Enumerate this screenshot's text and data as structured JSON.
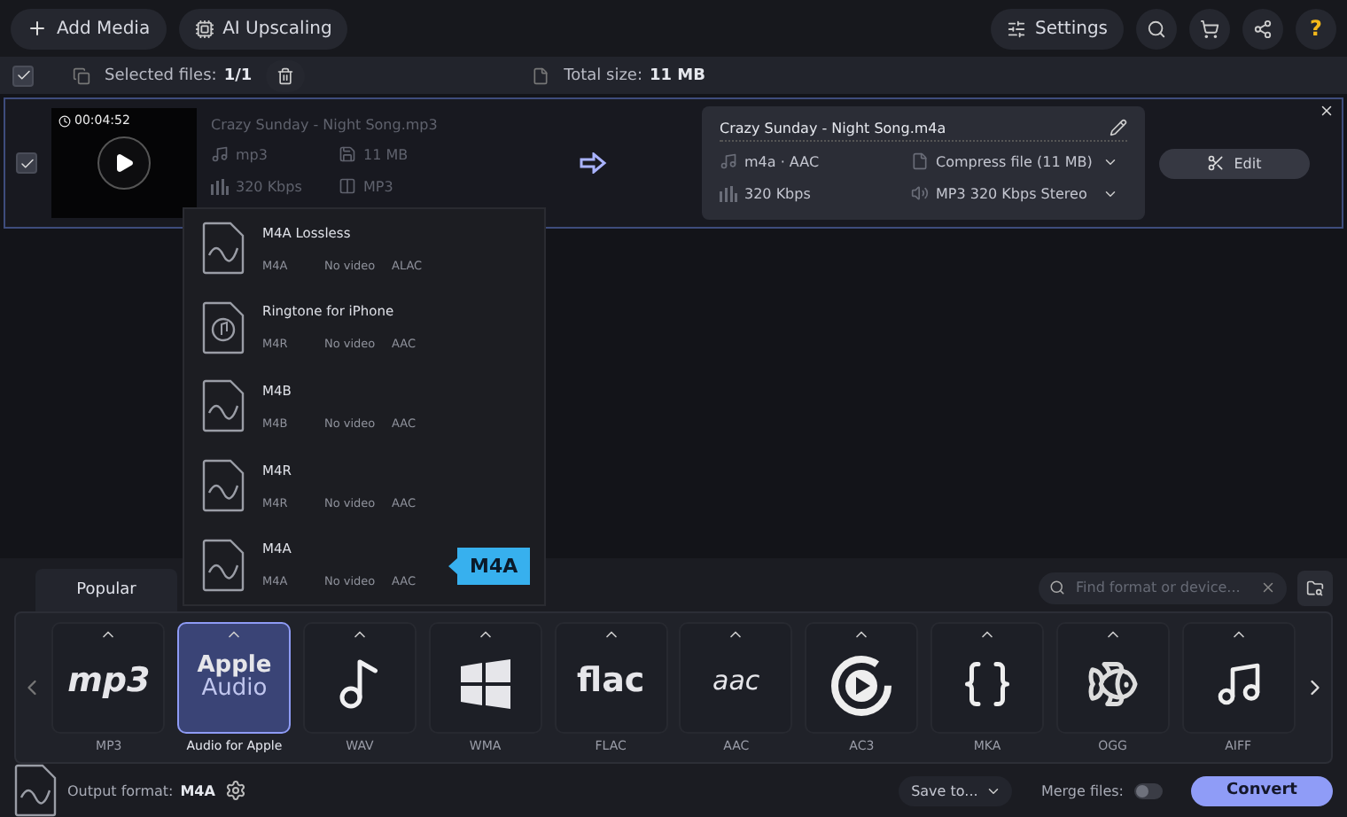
{
  "toolbar": {
    "add_media": "Add Media",
    "ai_upscaling": "AI Upscaling",
    "settings": "Settings",
    "help": "?"
  },
  "selection": {
    "checked": true,
    "label": "Selected files:",
    "count": "1/1",
    "total_label": "Total size:",
    "total": "11 MB"
  },
  "file": {
    "checked": true,
    "duration": "00:04:52",
    "source_name": "Crazy Sunday - Night Song.mp3",
    "source_format": "mp3",
    "source_size": "11 MB",
    "source_bitrate": "320 Kbps",
    "source_codec": "MP3",
    "output_name": "Crazy Sunday - Night Song.m4a",
    "output_format": "m4a · AAC",
    "output_bitrate": "320 Kbps",
    "compress": "Compress file (11 MB)",
    "audio": "MP3 320 Kbps Stereo",
    "edit": "Edit"
  },
  "presets": [
    {
      "kind": "file",
      "name": "M4A Lossless",
      "container": "M4A",
      "video": "No video",
      "audio": "ALAC"
    },
    {
      "kind": "ringtone",
      "name": "Ringtone for iPhone",
      "container": "M4R",
      "video": "No video",
      "audio": "AAC"
    },
    {
      "kind": "file",
      "name": "M4B",
      "container": "M4B",
      "video": "No video",
      "audio": "AAC"
    },
    {
      "kind": "file",
      "name": "M4R",
      "container": "M4R",
      "video": "No video",
      "audio": "AAC"
    },
    {
      "kind": "file",
      "name": "M4A",
      "container": "M4A",
      "video": "No video",
      "audio": "AAC"
    }
  ],
  "tooltip": "M4A",
  "tabs": [
    {
      "label": "Popular",
      "selected": true
    }
  ],
  "search": {
    "placeholder": "Find format or device..."
  },
  "formats": [
    {
      "kind": "mp3",
      "logo": "mp3",
      "caption": "MP3",
      "selected": false
    },
    {
      "kind": "apple",
      "logo": "Apple",
      "logo_sub": "Audio",
      "caption": "Audio for Apple",
      "selected": true
    },
    {
      "kind": "note",
      "caption": "WAV",
      "selected": false
    },
    {
      "kind": "windows",
      "caption": "WMA",
      "selected": false
    },
    {
      "kind": "flac",
      "logo": "flac",
      "caption": "FLAC",
      "selected": false
    },
    {
      "kind": "aac",
      "logo": "aac",
      "caption": "AAC",
      "selected": false
    },
    {
      "kind": "play",
      "caption": "AC3",
      "selected": false
    },
    {
      "kind": "braces",
      "caption": "MKA",
      "selected": false
    },
    {
      "kind": "fish",
      "caption": "OGG",
      "selected": false
    },
    {
      "kind": "music",
      "caption": "AIFF",
      "selected": false
    }
  ],
  "footer": {
    "output_label": "Output format:",
    "output_value": "M4A",
    "save_to": "Save to...",
    "merge_label": "Merge files:",
    "merge_on": false,
    "convert": "Convert"
  }
}
